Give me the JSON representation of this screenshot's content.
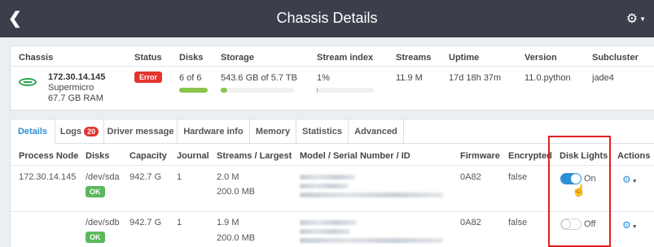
{
  "header": {
    "title": "Chassis Details",
    "back_icon": "chevron-left-icon",
    "settings_icon": "gear-icon"
  },
  "chassis": {
    "headers": [
      "Chassis",
      "Status",
      "Disks",
      "Storage",
      "Stream index",
      "Streams",
      "Uptime",
      "Version",
      "Subcluster"
    ],
    "ip": "172.30.14.145",
    "vendor": "Supermicro",
    "ram": "67.7 GB RAM",
    "status": "Error",
    "disks": "6 of 6",
    "disks_fraction": 1.0,
    "storage": "543.6 GB of 5.7 TB",
    "storage_fraction": 0.093,
    "stream_index": "1%",
    "stream_index_fraction": 0.01,
    "streams": "11.9 M",
    "uptime": "17d 18h 37m",
    "version": "11.0.python",
    "subcluster": "jade4"
  },
  "tabs": [
    {
      "label": "Details",
      "active": true
    },
    {
      "label": "Logs",
      "count": "20"
    },
    {
      "label": "Driver message"
    },
    {
      "label": "Hardware info"
    },
    {
      "label": "Memory"
    },
    {
      "label": "Statistics"
    },
    {
      "label": "Advanced"
    }
  ],
  "table": {
    "columns": [
      "Process Node",
      "Disks",
      "Capacity",
      "Journal",
      "Streams / Largest",
      "Model / Serial Number / ID",
      "Firmware",
      "Encrypted",
      "Disk Lights",
      "Actions"
    ],
    "rows": [
      {
        "node": "172.30.14.145",
        "disk": "/dev/sda",
        "status": "OK",
        "capacity": "942.7 G",
        "journal": "1",
        "streams": "2.0 M",
        "largest": "200.0 MB",
        "firmware": "0A82",
        "encrypted": "false",
        "light_state": true,
        "light_label": "On"
      },
      {
        "node": "",
        "disk": "/dev/sdb",
        "status": "OK",
        "capacity": "942.7 G",
        "journal": "1",
        "streams": "1.9 M",
        "largest": "200.0 MB",
        "firmware": "0A82",
        "encrypted": "false",
        "light_state": false,
        "light_label": "Off"
      }
    ]
  },
  "colors": {
    "accent": "#2f8fd6",
    "error": "#e3342f",
    "ok": "#5cb85c",
    "topbar": "#3a3f4b",
    "highlight": "#e02020"
  }
}
